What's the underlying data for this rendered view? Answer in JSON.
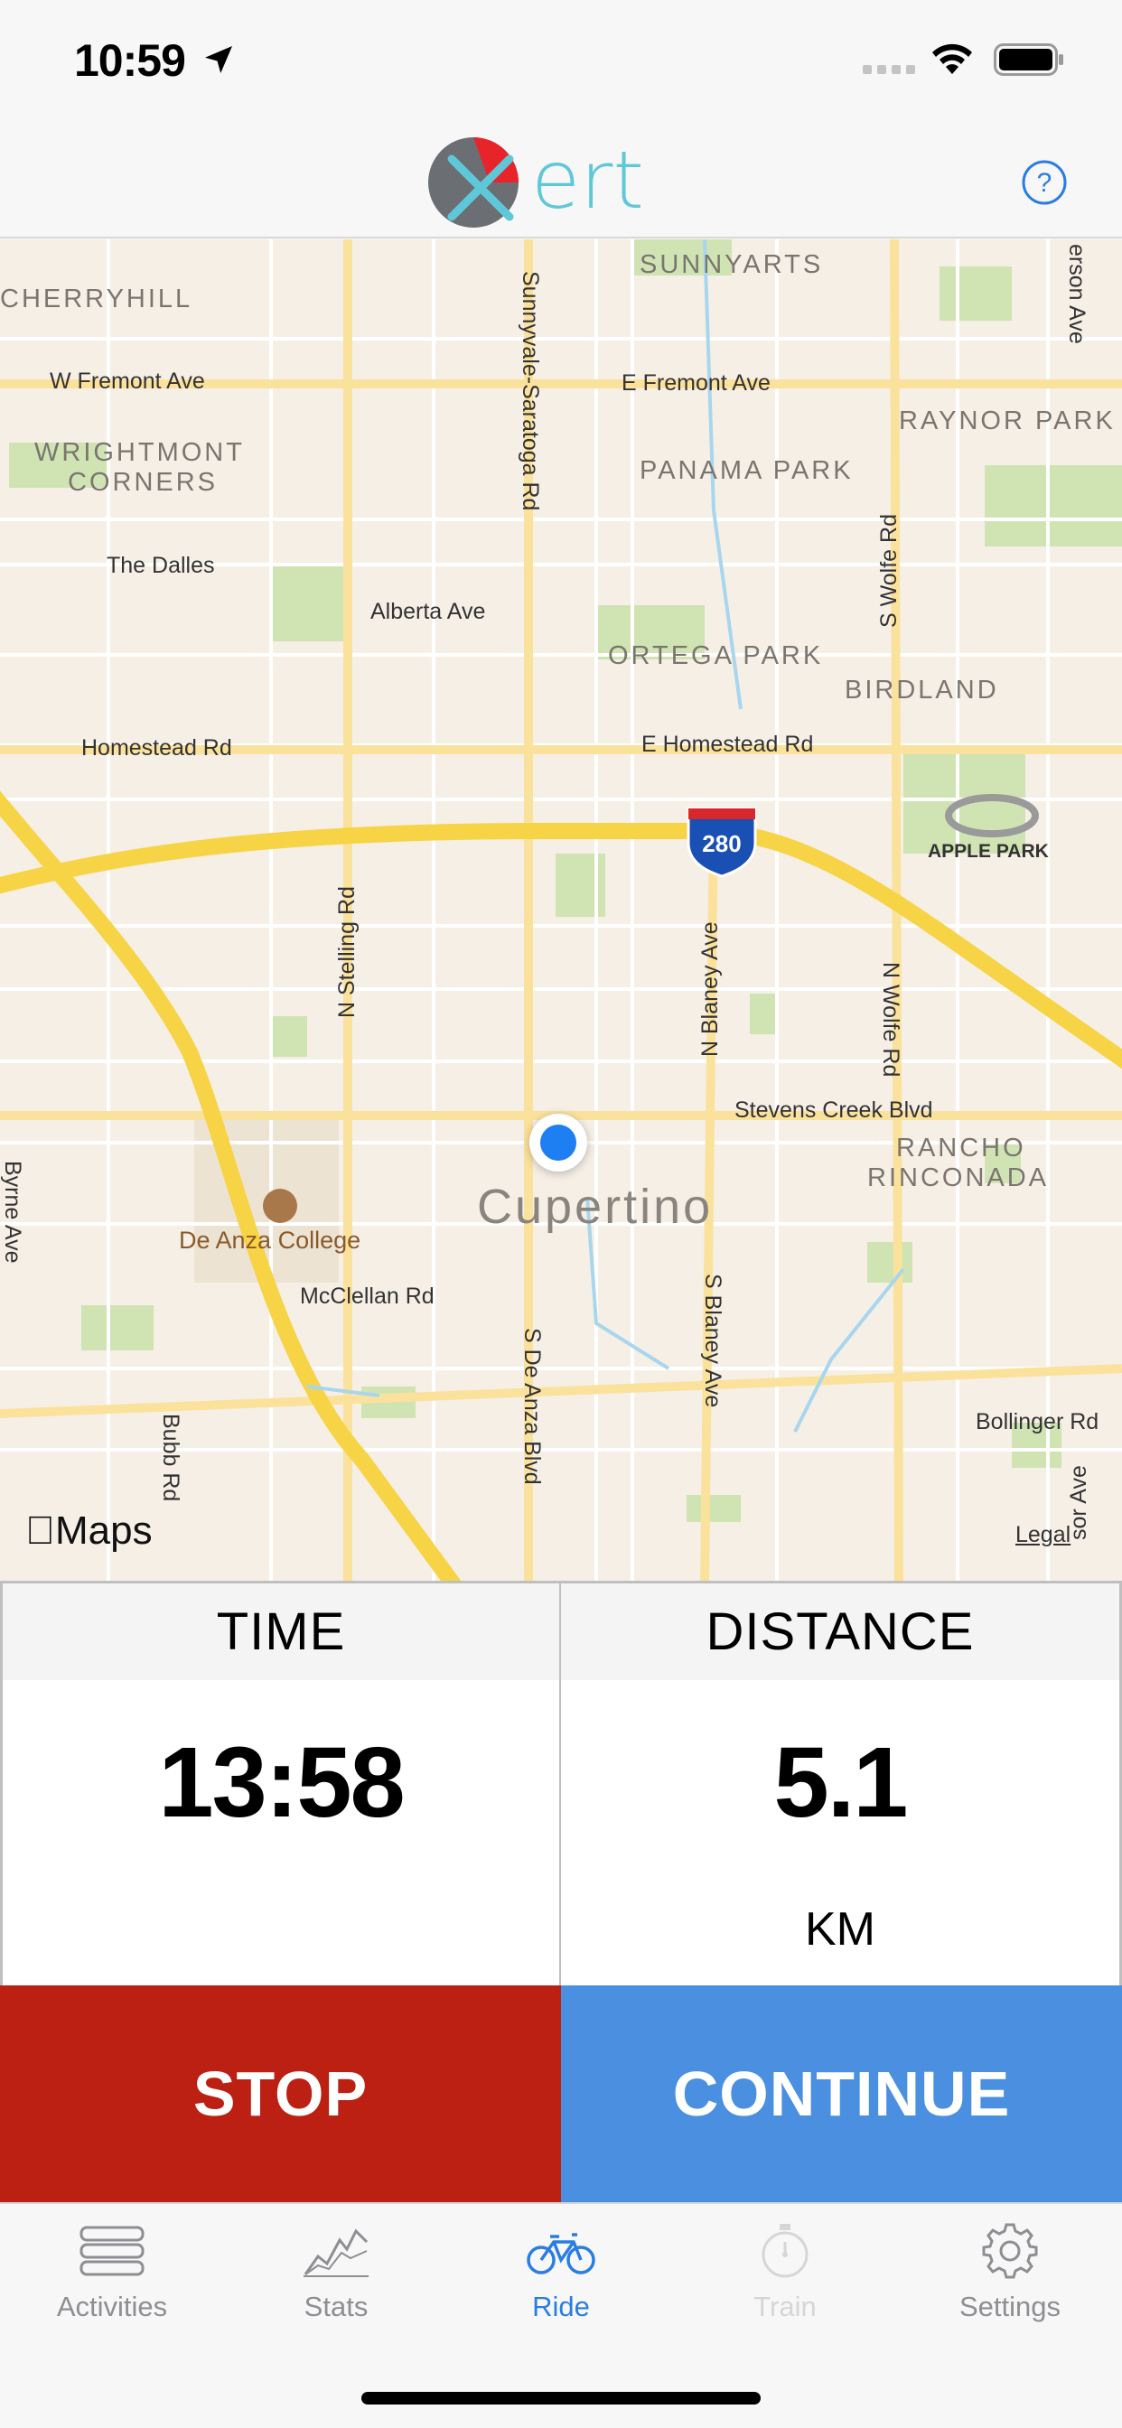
{
  "status_bar": {
    "time": "10:59",
    "icons": [
      "location-arrow-icon",
      "signal-icon",
      "wifi-icon",
      "battery-icon"
    ]
  },
  "header": {
    "logo_text": "ert",
    "help_icon": "question-circle-icon",
    "accent_color": "#5ec8d8",
    "logo_red": "#e8242b"
  },
  "map": {
    "brand": "Maps",
    "legal": "Legal",
    "city": "Cupertino",
    "districts": [
      "CHERRYHILL",
      "SUNNYARTS",
      "RAYNOR PARK",
      "WRIGHTMONT",
      "CORNERS",
      "PANAMA PARK",
      "ORTEGA PARK",
      "BIRDLAND",
      "RANCHO",
      "RINCONADA"
    ],
    "roads": [
      "W Fremont Ave",
      "E Fremont Ave",
      "The Dalles",
      "Alberta Ave",
      "Homestead Rd",
      "E Homestead Rd",
      "Stevens Creek Blvd",
      "McClellan Rd",
      "Bollinger Rd",
      "Sunnyvale-Saratoga Rd",
      "S Wolfe Rd",
      "N Wolfe Rd",
      "N Stelling Rd",
      "N Blaney Ave",
      "S Blaney Ave",
      "S De Anza Blvd",
      "Bubb Rd",
      "Byrne Ave",
      "erson Ave",
      "sor Ave"
    ],
    "highway_shield": "280",
    "poi_college": "De Anza College",
    "poi_apple": "APPLE PARK"
  },
  "stats": {
    "time_label": "TIME",
    "time_value": "13:58",
    "distance_label": "DISTANCE",
    "distance_value": "5.1",
    "distance_unit": "KM"
  },
  "actions": {
    "stop_label": "STOP",
    "continue_label": "CONTINUE",
    "stop_color": "#bb2013",
    "continue_color": "#4a8fe0"
  },
  "tabs": [
    {
      "label": "Activities",
      "icon": "list-icon",
      "state": "normal"
    },
    {
      "label": "Stats",
      "icon": "chart-icon",
      "state": "normal"
    },
    {
      "label": "Ride",
      "icon": "bicycle-icon",
      "state": "active"
    },
    {
      "label": "Train",
      "icon": "stopwatch-icon",
      "state": "disabled"
    },
    {
      "label": "Settings",
      "icon": "gear-icon",
      "state": "normal"
    }
  ]
}
